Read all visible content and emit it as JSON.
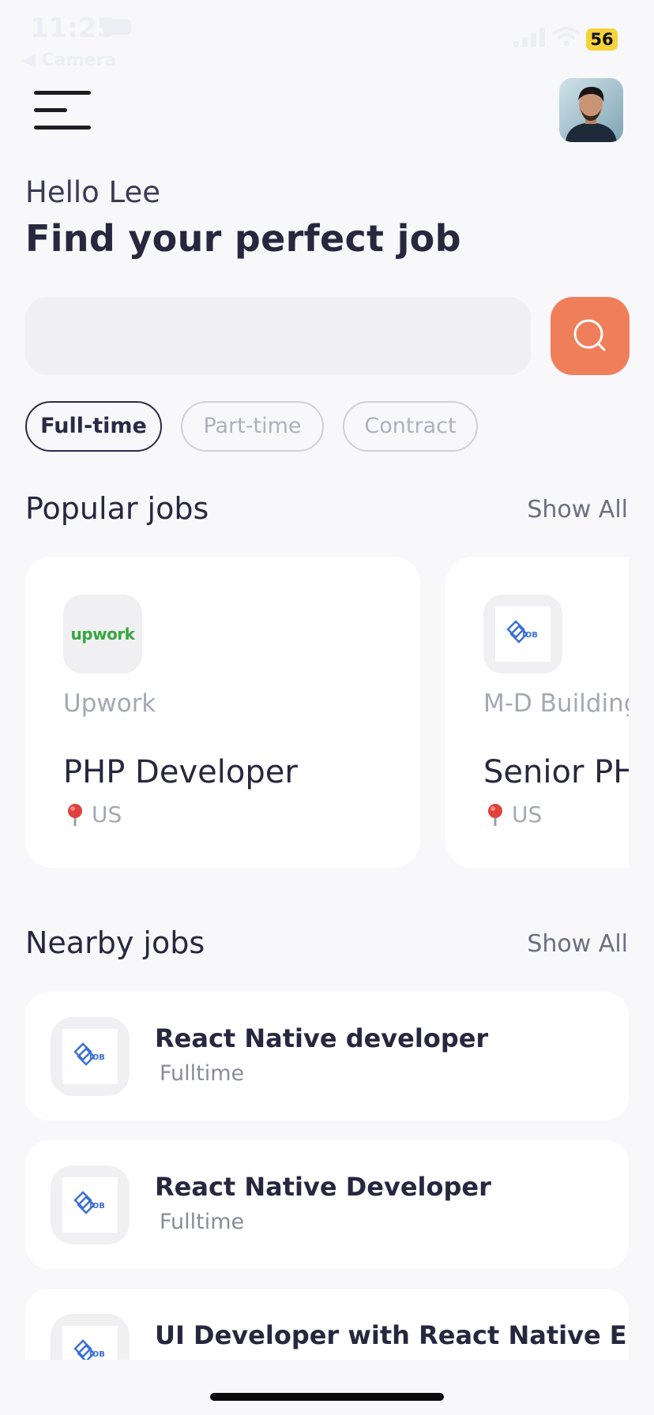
{
  "status_bar": {
    "time": "11:25",
    "back_label": "◀ Camera",
    "battery": "56"
  },
  "header": {
    "greeting": "Hello Lee",
    "headline": "Find your perfect job"
  },
  "search": {
    "value": "",
    "placeholder": ""
  },
  "filters": [
    {
      "label": "Full-time",
      "active": true
    },
    {
      "label": "Part-time",
      "active": false
    },
    {
      "label": "Contract",
      "active": false
    }
  ],
  "popular": {
    "title": "Popular jobs",
    "show_all": "Show All",
    "cards": [
      {
        "company": "Upwork",
        "title": "PHP Developer",
        "location": "US",
        "logo": "upwork-logo",
        "logo_text": "upwork"
      },
      {
        "company": "M-D Building",
        "title": "Senior PHP",
        "location": "US",
        "logo": "job-logo",
        "logo_text": "JOB"
      }
    ]
  },
  "nearby": {
    "title": "Nearby jobs",
    "show_all": "Show All",
    "items": [
      {
        "title": "React Native developer",
        "type": "Fulltime",
        "logo": "job-logo"
      },
      {
        "title": "React Native Developer",
        "type": "Fulltime",
        "logo": "job-logo"
      },
      {
        "title": "UI Developer with React Native E...",
        "type": "",
        "logo": "job-logo"
      }
    ]
  },
  "colors": {
    "accent": "#ef7f5a",
    "text_dark": "#29273f",
    "muted": "#a5a7b5",
    "background": "#f8f8fb",
    "job_logo_blue": "#3b6fd6"
  }
}
